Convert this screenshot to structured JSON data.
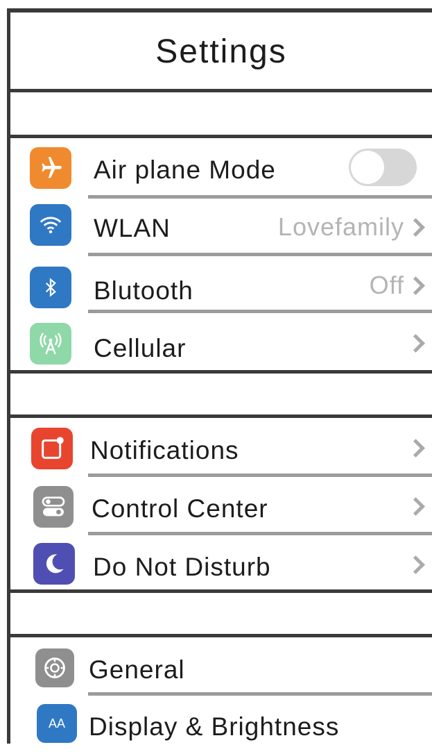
{
  "header": {
    "title": "Settings"
  },
  "groups": [
    {
      "items": [
        {
          "label": "Air plane Mode",
          "icon": "airplane-icon",
          "icon_color": "#f08a2e",
          "control": "toggle",
          "on": false
        },
        {
          "label": "WLAN",
          "value": "Lovefamily",
          "icon": "wifi-icon",
          "icon_color": "#2f78c4"
        },
        {
          "label": "Blutooth",
          "value": "Off",
          "icon": "bluetooth-icon",
          "icon_color": "#2f78c4"
        },
        {
          "label": "Cellular",
          "icon": "cellular-icon",
          "icon_color": "#8fd8a8"
        }
      ]
    },
    {
      "items": [
        {
          "label": "Notifications",
          "icon": "notifications-icon",
          "icon_color": "#e8452e"
        },
        {
          "label": "Control Center",
          "icon": "control-center-icon",
          "icon_color": "#8f8f8f"
        },
        {
          "label": "Do Not Disturb",
          "icon": "moon-icon",
          "icon_color": "#4f4fb3"
        }
      ]
    },
    {
      "items": [
        {
          "label": "General",
          "icon": "gear-icon",
          "icon_color": "#8f8f8f"
        },
        {
          "label": "Display & Brightness",
          "icon": "display-icon",
          "icon_color": "#2f78c4",
          "icon_text": "AA"
        }
      ]
    }
  ]
}
